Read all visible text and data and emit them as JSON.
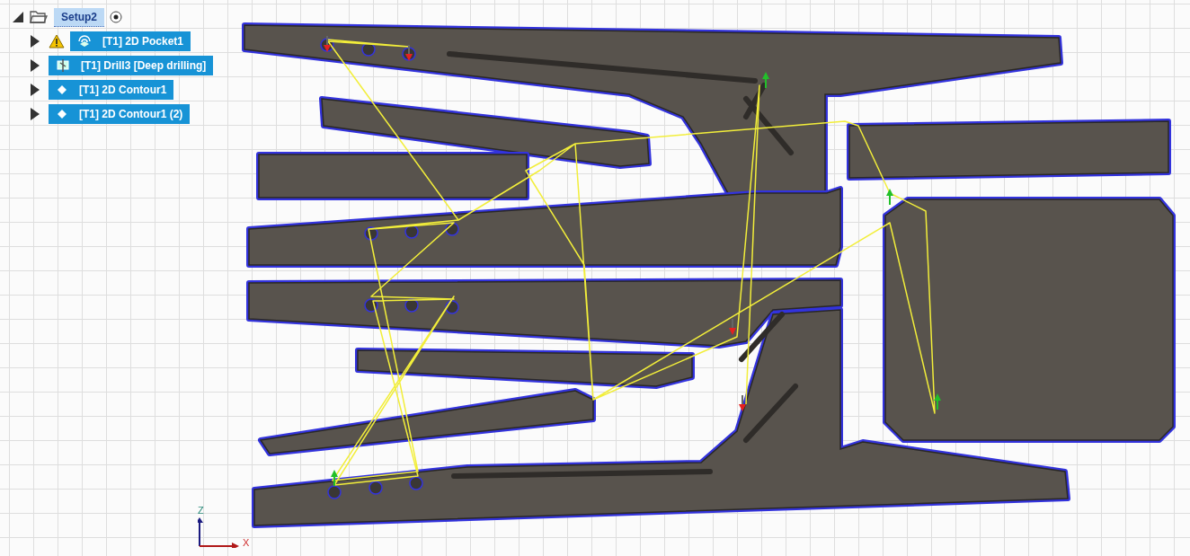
{
  "browser_tree": {
    "setup": {
      "label": "Setup2",
      "expanded": true,
      "selected": true
    },
    "operations": [
      {
        "label": "[T1] 2D Pocket1",
        "kind": "pocket",
        "warning": true,
        "selected": true
      },
      {
        "label": "[T1] Drill3 [Deep drilling]",
        "kind": "drill",
        "warning": false,
        "selected": true
      },
      {
        "label": "[T1] 2D Contour1",
        "kind": "contour",
        "warning": false,
        "selected": true
      },
      {
        "label": "[T1] 2D Contour1 (2)",
        "kind": "contour",
        "warning": false,
        "selected": true
      }
    ]
  },
  "axis_triad": {
    "z_label": "Z",
    "x_label": "X"
  }
}
